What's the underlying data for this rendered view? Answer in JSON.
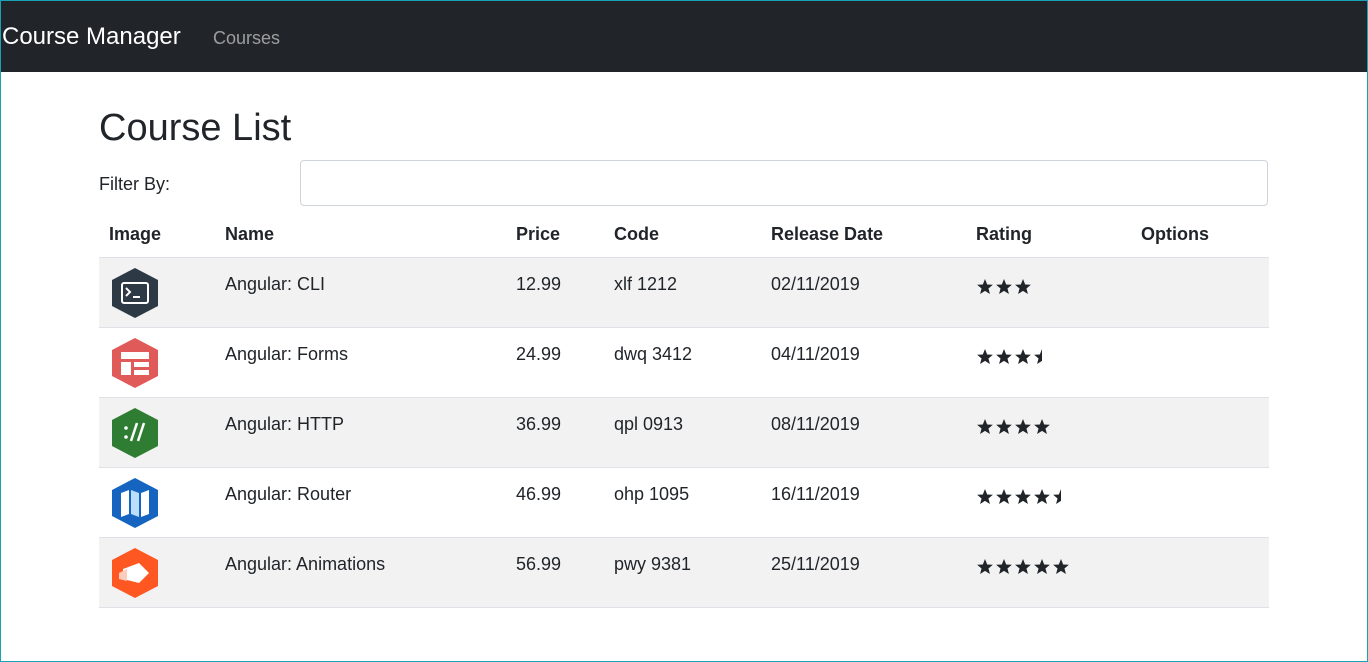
{
  "navbar": {
    "brand": "Course Manager",
    "links": [
      "Courses"
    ]
  },
  "page": {
    "title": "Course List",
    "filter_label": "Filter By:",
    "filter_value": ""
  },
  "table": {
    "headers": [
      "Image",
      "Name",
      "Price",
      "Code",
      "Release Date",
      "Rating",
      "Options"
    ],
    "rows": [
      {
        "icon": "terminal-icon",
        "color": "#2d3a45",
        "name": "Angular: CLI",
        "price": "12.99",
        "code": "xlf 1212",
        "release": "02/11/2019",
        "rating": 3
      },
      {
        "icon": "form-layout-icon",
        "color": "#e05a5a",
        "name": "Angular: Forms",
        "price": "24.99",
        "code": "dwq 3412",
        "release": "04/11/2019",
        "rating": 3.5
      },
      {
        "icon": "http-slashes-icon",
        "color": "#2e7d32",
        "name": "Angular: HTTP",
        "price": "36.99",
        "code": "qpl 0913",
        "release": "08/11/2019",
        "rating": 4
      },
      {
        "icon": "map-icon",
        "color": "#1565c0",
        "name": "Angular: Router",
        "price": "46.99",
        "code": "ohp 1095",
        "release": "16/11/2019",
        "rating": 4.5
      },
      {
        "icon": "motion-shape-icon",
        "color": "#ff5722",
        "name": "Angular: Animations",
        "price": "56.99",
        "code": "pwy 9381",
        "release": "25/11/2019",
        "rating": 5
      }
    ]
  }
}
